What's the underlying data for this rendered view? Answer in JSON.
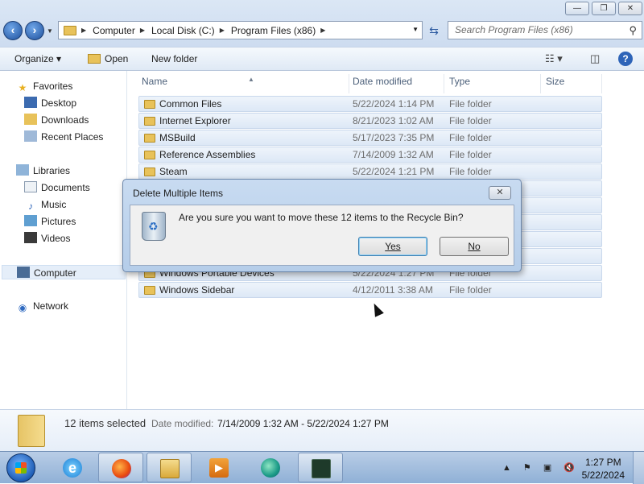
{
  "window": {
    "minimize": "—",
    "maximize": "❐",
    "close": "✕"
  },
  "address": {
    "crumbs": [
      "Computer",
      "Local Disk (C:)",
      "Program Files (x86)"
    ],
    "search_placeholder": "Search Program Files (x86)"
  },
  "toolbar": {
    "organize": "Organize ▾",
    "open": "Open",
    "new_folder": "New folder"
  },
  "nav": {
    "favorites": "Favorites",
    "desktop": "Desktop",
    "downloads": "Downloads",
    "recent": "Recent Places",
    "libraries": "Libraries",
    "documents": "Documents",
    "music": "Music",
    "pictures": "Pictures",
    "videos": "Videos",
    "computer": "Computer",
    "network": "Network"
  },
  "columns": {
    "name": "Name",
    "date": "Date modified",
    "type": "Type",
    "size": "Size"
  },
  "files": [
    {
      "name": "Common Files",
      "date": "5/22/2024 1:14 PM",
      "type": "File folder"
    },
    {
      "name": "Internet Explorer",
      "date": "8/21/2023 1:02 AM",
      "type": "File folder"
    },
    {
      "name": "MSBuild",
      "date": "5/17/2023 7:35 PM",
      "type": "File folder"
    },
    {
      "name": "Reference Assemblies",
      "date": "7/14/2009 1:32 AM",
      "type": "File folder"
    },
    {
      "name": "Steam",
      "date": "5/22/2024 1:21 PM",
      "type": "File folder"
    },
    {
      "name": "",
      "date": "",
      "type": ""
    },
    {
      "name": "",
      "date": "",
      "type": ""
    },
    {
      "name": "",
      "date": "",
      "type": ""
    },
    {
      "name": "",
      "date": "",
      "type": ""
    },
    {
      "name": "",
      "date": "",
      "type": ""
    },
    {
      "name": "Windows Portable Devices",
      "date": "5/22/2024 1:27 PM",
      "type": "File folder"
    },
    {
      "name": "Windows Sidebar",
      "date": "4/12/2011 3:38 AM",
      "type": "File folder"
    }
  ],
  "details": {
    "selected": "12 items selected",
    "date_label": "Date modified:",
    "date_value": "7/14/2009 1:32 AM - 5/22/2024 1:27 PM"
  },
  "dialog": {
    "title": "Delete Multiple Items",
    "close": "✕",
    "message": "Are you sure you want to move these 12 items to the Recycle Bin?",
    "yes": "Yes",
    "no": "No"
  },
  "taskbar": {
    "time": "1:27 PM",
    "date": "5/22/2024",
    "tray_icons": "▲ ⚑ ▣ 🔇"
  }
}
